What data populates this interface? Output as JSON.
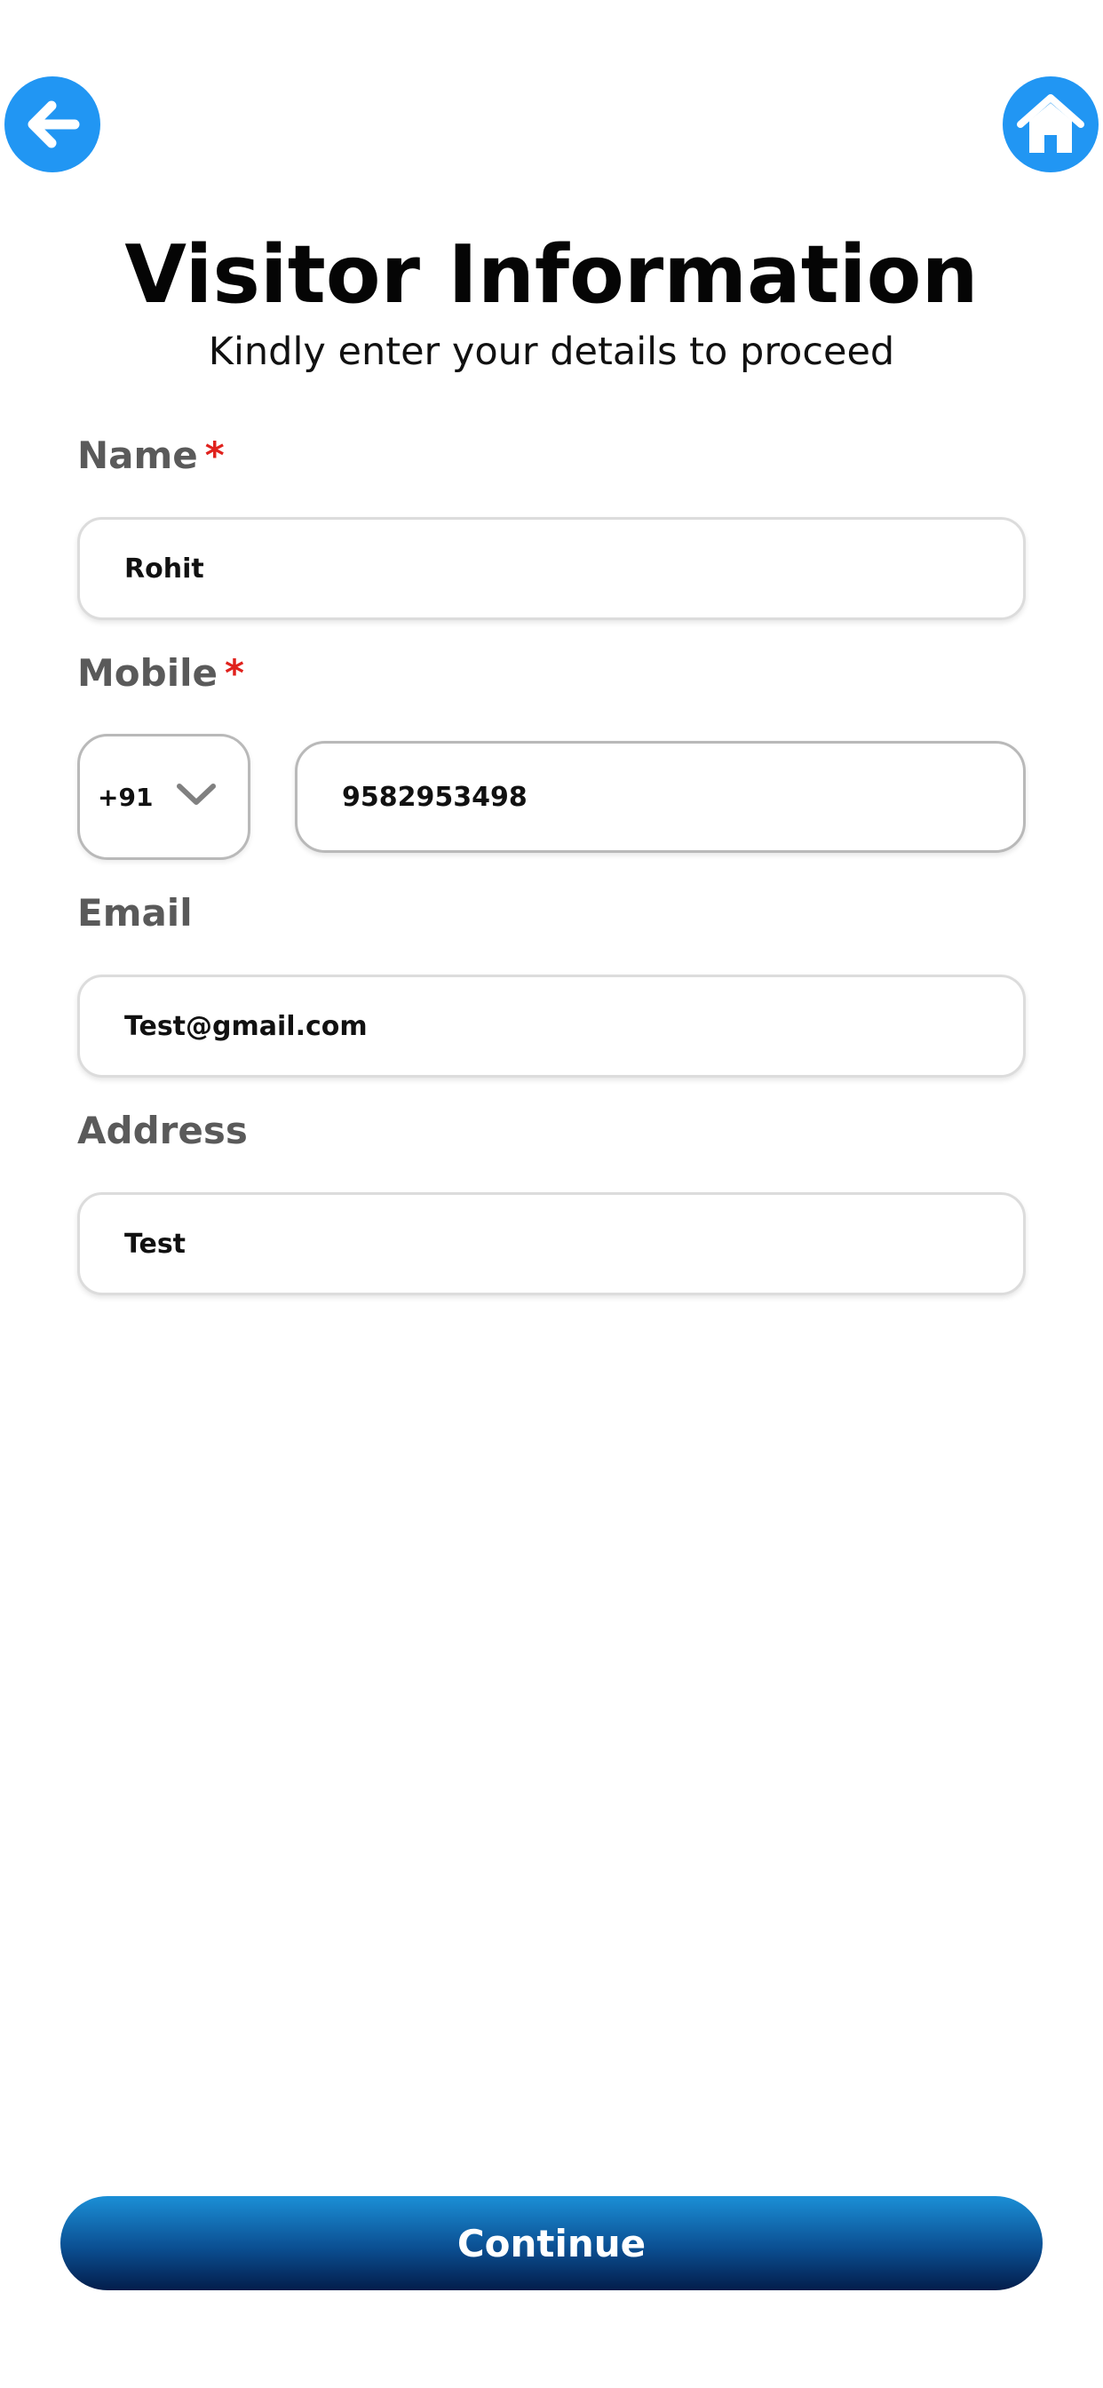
{
  "header": {
    "title": "Visitor Information",
    "subtitle": "Kindly enter your details to proceed"
  },
  "icons": {
    "back": "arrow-left-icon",
    "home": "home-icon",
    "dropdown": "chevron-down-icon"
  },
  "colors": {
    "accent": "#2196f3",
    "required": "#e0221d",
    "button_top": "#1b8fd6",
    "button_bottom": "#031d4b"
  },
  "form": {
    "name": {
      "label": "Name",
      "required_mark": "*",
      "value": "Rohit"
    },
    "mobile": {
      "label": "Mobile",
      "required_mark": "*",
      "country_code": "+91",
      "value": "9582953498"
    },
    "email": {
      "label": "Email",
      "value": "Test@gmail.com"
    },
    "address": {
      "label": "Address",
      "value": "Test"
    }
  },
  "actions": {
    "continue_label": "Continue"
  }
}
